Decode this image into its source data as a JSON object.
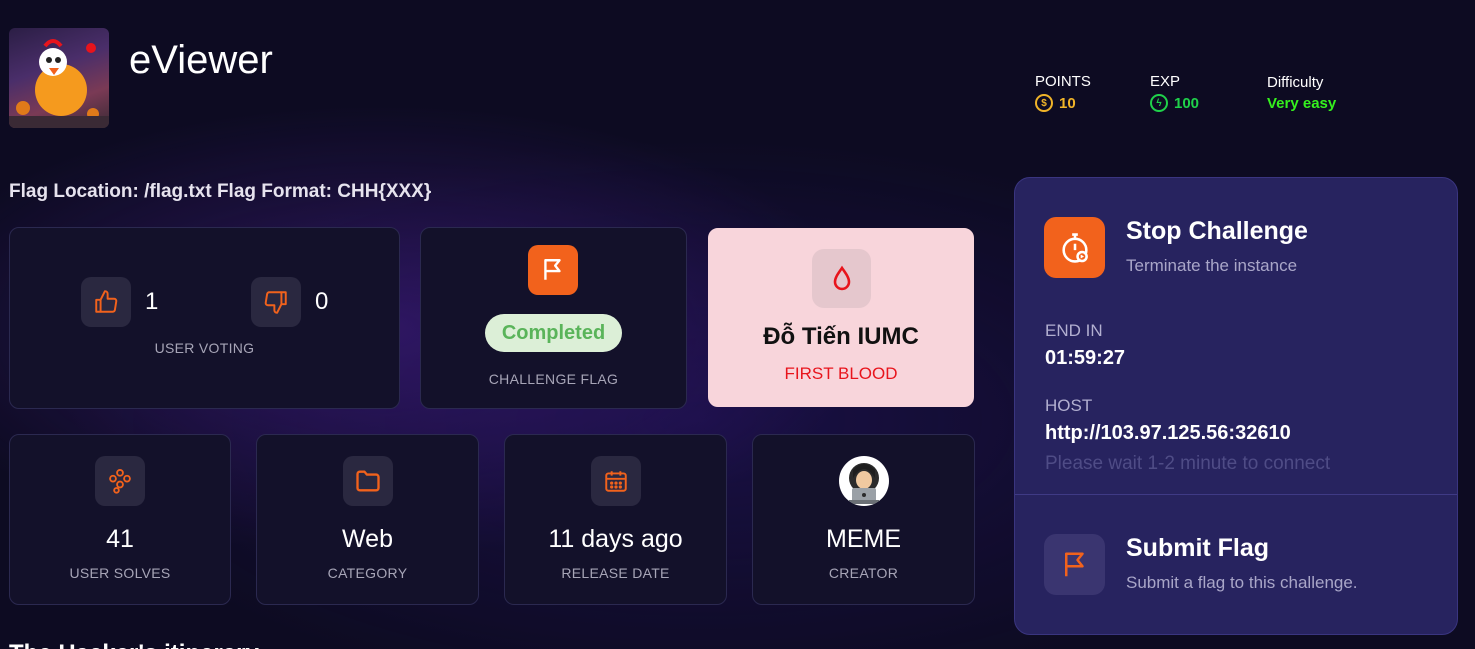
{
  "header": {
    "title": "eViewer",
    "stats": {
      "points_label": "POINTS",
      "points_value": "10",
      "exp_label": "EXP",
      "exp_value": "100",
      "difficulty_label": "Difficulty",
      "difficulty_value": "Very easy"
    }
  },
  "flag_info": "Flag Location: /flag.txt Flag Format: CHH{XXX}",
  "voting": {
    "up_count": "1",
    "down_count": "0",
    "caption": "USER VOTING"
  },
  "challenge_flag": {
    "status": "Completed",
    "caption": "CHALLENGE FLAG"
  },
  "first_blood": {
    "name": "Đỗ Tiến IUMC",
    "caption": "FIRST BLOOD"
  },
  "info_cards": [
    {
      "value": "41",
      "caption": "USER SOLVES",
      "icon": "users-icon"
    },
    {
      "value": "Web",
      "caption": "CATEGORY",
      "icon": "folder-icon"
    },
    {
      "value": "11 days ago",
      "caption": "RELEASE DATE",
      "icon": "calendar-icon"
    },
    {
      "value": "MEME",
      "caption": "CREATOR",
      "icon": "hacker-avatar"
    }
  ],
  "panel": {
    "stop_title": "Stop Challenge",
    "stop_sub": "Terminate the instance",
    "end_label": "END IN",
    "end_value": "01:59:27",
    "host_label": "HOST",
    "host_value": "http://103.97.125.56:32610",
    "host_note": "Please wait 1-2 minute to connect",
    "submit_title": "Submit Flag",
    "submit_sub": "Submit a flag to this challenge."
  },
  "bottom_heading": "The Hacker's itinerary",
  "colors": {
    "orange": "#f2621c",
    "points": "#f0b429",
    "exp": "#1fd14a",
    "difficulty": "#35f01e",
    "first_blood_text": "#e8141c"
  }
}
